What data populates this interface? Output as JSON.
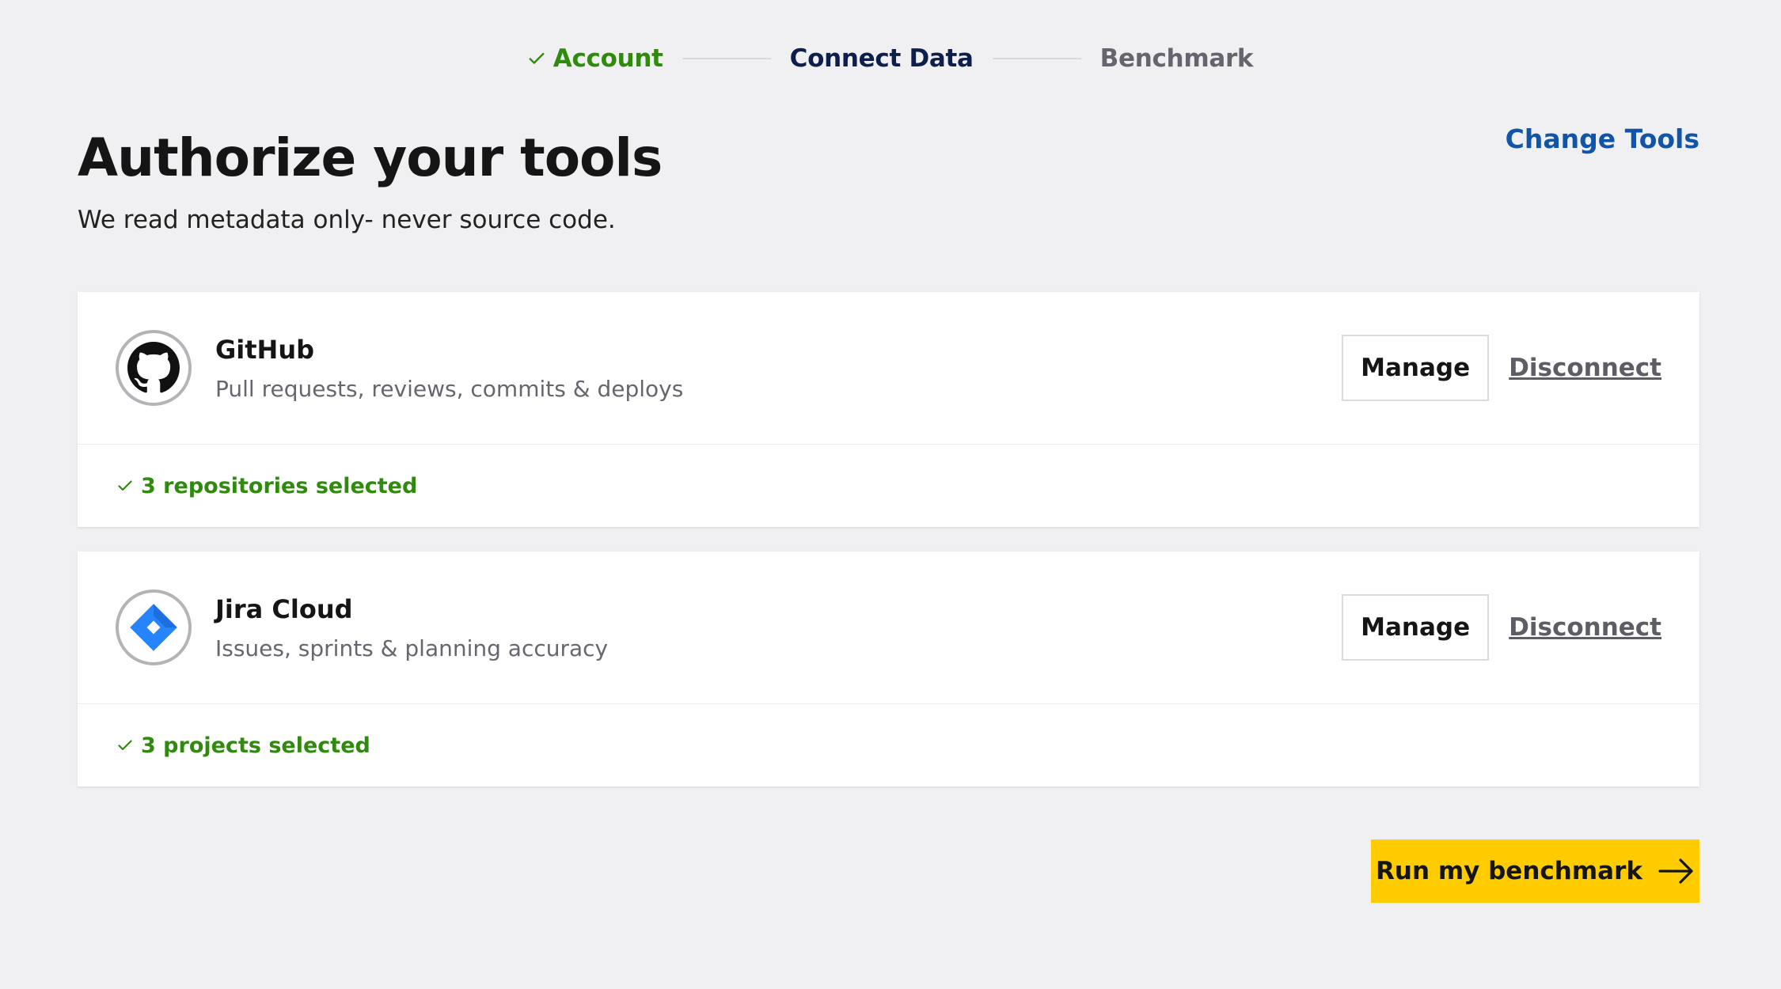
{
  "stepper": {
    "steps": [
      {
        "label": "Account",
        "state": "done"
      },
      {
        "label": "Connect Data",
        "state": "current"
      },
      {
        "label": "Benchmark",
        "state": "upcoming"
      }
    ]
  },
  "header": {
    "title": "Authorize your tools",
    "subtitle": "We read metadata only- never source code.",
    "change_tools_label": "Change Tools"
  },
  "tools": [
    {
      "name": "GitHub",
      "description": "Pull requests, reviews, commits & deploys",
      "icon": "github-icon",
      "manage_label": "Manage",
      "disconnect_label": "Disconnect",
      "status": "3 repositories selected"
    },
    {
      "name": "Jira Cloud",
      "description": "Issues, sprints & planning accuracy",
      "icon": "jira-icon",
      "manage_label": "Manage",
      "disconnect_label": "Disconnect",
      "status": "3 projects selected"
    }
  ],
  "footer": {
    "run_label": "Run my benchmark"
  },
  "colors": {
    "background": "#f0f0f2",
    "success": "#2f8a0d",
    "link": "#1155a8",
    "primary_button": "#ffcc00",
    "jira_blue": "#2684ff"
  }
}
